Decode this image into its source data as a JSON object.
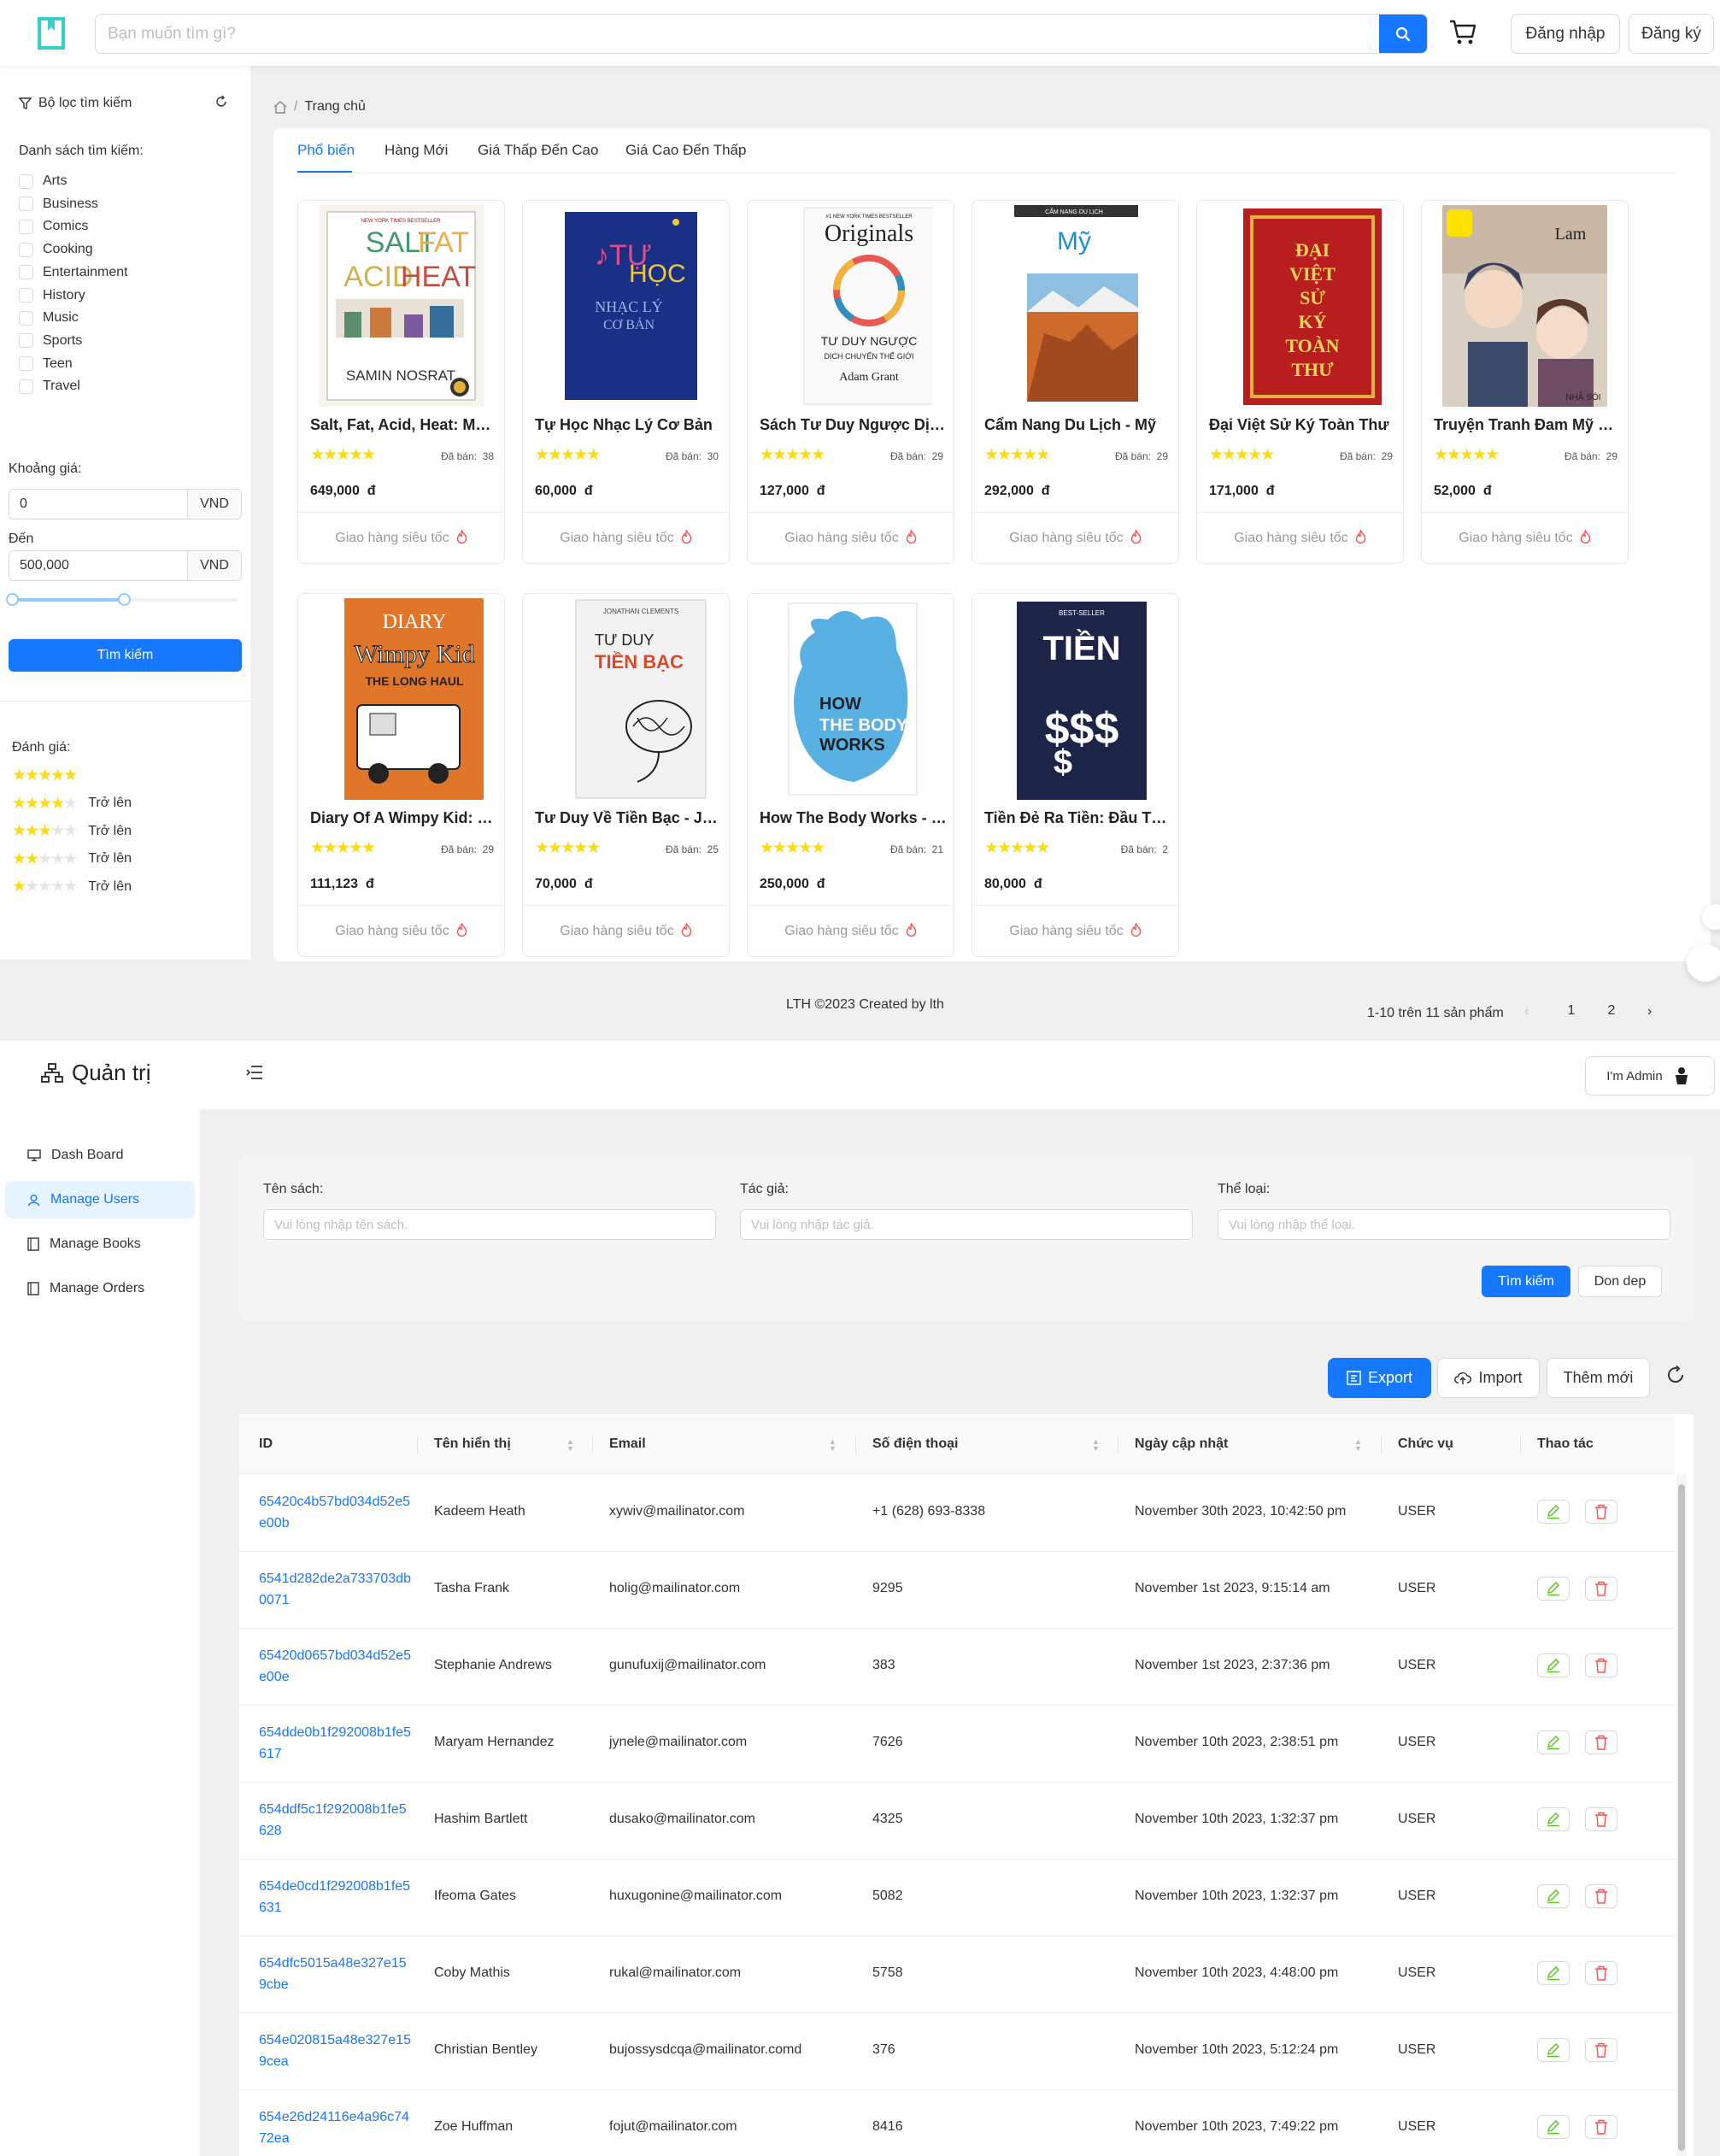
{
  "store": {
    "search_placeholder": "Bạn muốn tìm gì?",
    "login": "Đăng nhập",
    "register": "Đăng ký",
    "filter": {
      "title": "Bộ lọc tìm kiếm",
      "category_heading": "Danh sách tìm kiếm:",
      "categories": [
        "Arts",
        "Business",
        "Comics",
        "Cooking",
        "Entertainment",
        "History",
        "Music",
        "Sports",
        "Teen",
        "Travel"
      ],
      "price_label": "Khoảng giá:",
      "price_from": "0",
      "to_label": "Đến",
      "price_to": "500,000",
      "currency": "VND",
      "search_button": "Tìm kiếm",
      "rating_label": "Đánh giá:",
      "rating_suffix": "Trở lên",
      "ratings": [
        5,
        4,
        3,
        2,
        1
      ]
    },
    "breadcrumb": {
      "home": "Trang chủ",
      "separator": "/"
    },
    "tabs": [
      "Phổ biến",
      "Hàng Mới",
      "Giá Thấp Đến Cao",
      "Giá Cao Đến Thấp"
    ],
    "sold_label": "Đã bán:",
    "shipping": "Giao hàng siêu tốc",
    "products": [
      {
        "name": "Salt, Fat, Acid, Heat: Mastering the Elements of Good Cooking",
        "sold": "38",
        "price": "649,000",
        "currency": "đ",
        "rating": 5,
        "cover": "Salt Fat Acid Heat"
      },
      {
        "name": "Tự Học Nhạc Lý Cơ Bản",
        "sold": "30",
        "price": "60,000",
        "currency": "đ",
        "rating": 5,
        "cover": "Tự Học Nhạc Lý"
      },
      {
        "name": "Sách Tư Duy Ngược Dịch Chuyển Thế Giới",
        "sold": "29",
        "price": "127,000",
        "currency": "đ",
        "rating": 5,
        "cover": "Originals"
      },
      {
        "name": "Cẩm Nang Du Lịch - Mỹ",
        "sold": "29",
        "price": "292,000",
        "currency": "đ",
        "rating": 5,
        "cover": "Mỹ"
      },
      {
        "name": "Đại Việt Sử Ký Toàn Thư",
        "sold": "29",
        "price": "171,000",
        "currency": "đ",
        "rating": 5,
        "cover": "Đại Việt"
      },
      {
        "name": "Truyện Tranh Đam Mỹ Lam Đăng Nhã Sói",
        "sold": "29",
        "price": "52,000",
        "currency": "đ",
        "rating": 5,
        "cover": "Manga"
      },
      {
        "name": "Diary Of A Wimpy Kid: The Long Haul",
        "sold": "29",
        "price": "111,123",
        "currency": "đ",
        "rating": 5,
        "cover": "Diary"
      },
      {
        "name": "Tư Duy Về Tiền Bạc - Jonathan Clements",
        "sold": "25",
        "price": "70,000",
        "currency": "đ",
        "rating": 5,
        "cover": "Tiền Bạc"
      },
      {
        "name": "How The Body Works - Hiểu Hết Về Cơ Thể",
        "sold": "21",
        "price": "250,000",
        "currency": "đ",
        "rating": 5,
        "cover": "Body"
      },
      {
        "name": "Tiền Đẻ Ra Tiền: Đầu Tư Tài Chính Thông Minh",
        "sold": "2",
        "price": "80,000",
        "currency": "đ",
        "rating": 5,
        "cover": "Tiền"
      }
    ],
    "footer": "LTH ©2023 Created by lth",
    "pagination": {
      "range": "1-10 trên 11 sản phẩm",
      "pages": [
        "1",
        "2"
      ],
      "current": "1"
    }
  },
  "admin": {
    "title": "Quản trị",
    "user_button": "I'm Admin",
    "menu": [
      "Dash Board",
      "Manage Users",
      "Manage Books",
      "Manage Orders"
    ],
    "active_menu": "Manage Users",
    "search": {
      "book_label": "Tên sách:",
      "book_placeholder": "Vui lòng nhập tên sách.",
      "author_label": "Tác giả:",
      "author_placeholder": "Vui lòng nhập tác giả.",
      "category_label": "Thể loại:",
      "category_placeholder": "Vui lòng nhập thể loại.",
      "search_button": "Tìm kiếm",
      "clear_button": "Don dep"
    },
    "toolbar": {
      "export": "Export",
      "import": "Import",
      "add": "Thêm mới"
    },
    "columns": [
      "ID",
      "Tên hiển thị",
      "Email",
      "Số điện thoại",
      "Ngày cập nhật",
      "Chức vụ",
      "Thao tác"
    ],
    "users": [
      {
        "id": "65420c4b57bd034d52e5e00b",
        "name": "Kadeem Heath",
        "email": "xywiv@mailinator.com",
        "phone": "+1 (628) 693-8338",
        "updated": "November 30th 2023, 10:42:50 pm",
        "role": "USER"
      },
      {
        "id": "6541d282de2a733703db0071",
        "name": "Tasha Frank",
        "email": "holig@mailinator.com",
        "phone": "9295",
        "updated": "November 1st 2023, 9:15:14 am",
        "role": "USER"
      },
      {
        "id": "65420d0657bd034d52e5e00e",
        "name": "Stephanie Andrews",
        "email": "gunufuxij@mailinator.com",
        "phone": "383",
        "updated": "November 1st 2023, 2:37:36 pm",
        "role": "USER"
      },
      {
        "id": "654dde0b1f292008b1fe5617",
        "name": "Maryam Hernandez",
        "email": "jynele@mailinator.com",
        "phone": "7626",
        "updated": "November 10th 2023, 2:38:51 pm",
        "role": "USER"
      },
      {
        "id": "654ddf5c1f292008b1fe5628",
        "name": "Hashim Bartlett",
        "email": "dusako@mailinator.com",
        "phone": "4325",
        "updated": "November 10th 2023, 1:32:37 pm",
        "role": "USER"
      },
      {
        "id": "654de0cd1f292008b1fe5631",
        "name": "Ifeoma Gates",
        "email": "huxugonine@mailinator.com",
        "phone": "5082",
        "updated": "November 10th 2023, 1:32:37 pm",
        "role": "USER"
      },
      {
        "id": "654dfc5015a48e327e159cbe",
        "name": "Coby Mathis",
        "email": "rukal@mailinator.com",
        "phone": "5758",
        "updated": "November 10th 2023, 4:48:00 pm",
        "role": "USER"
      },
      {
        "id": "654e020815a48e327e159cea",
        "name": "Christian Bentley",
        "email": "bujossysdcqa@mailinator.comd",
        "phone": "376",
        "updated": "November 10th 2023, 5:12:24 pm",
        "role": "USER"
      },
      {
        "id": "654e26d24116e4a96c7472ea",
        "name": "Zoe Huffman",
        "email": "fojut@mailinator.com",
        "phone": "8416",
        "updated": "November 10th 2023, 7:49:22 pm",
        "role": "USER"
      }
    ]
  }
}
